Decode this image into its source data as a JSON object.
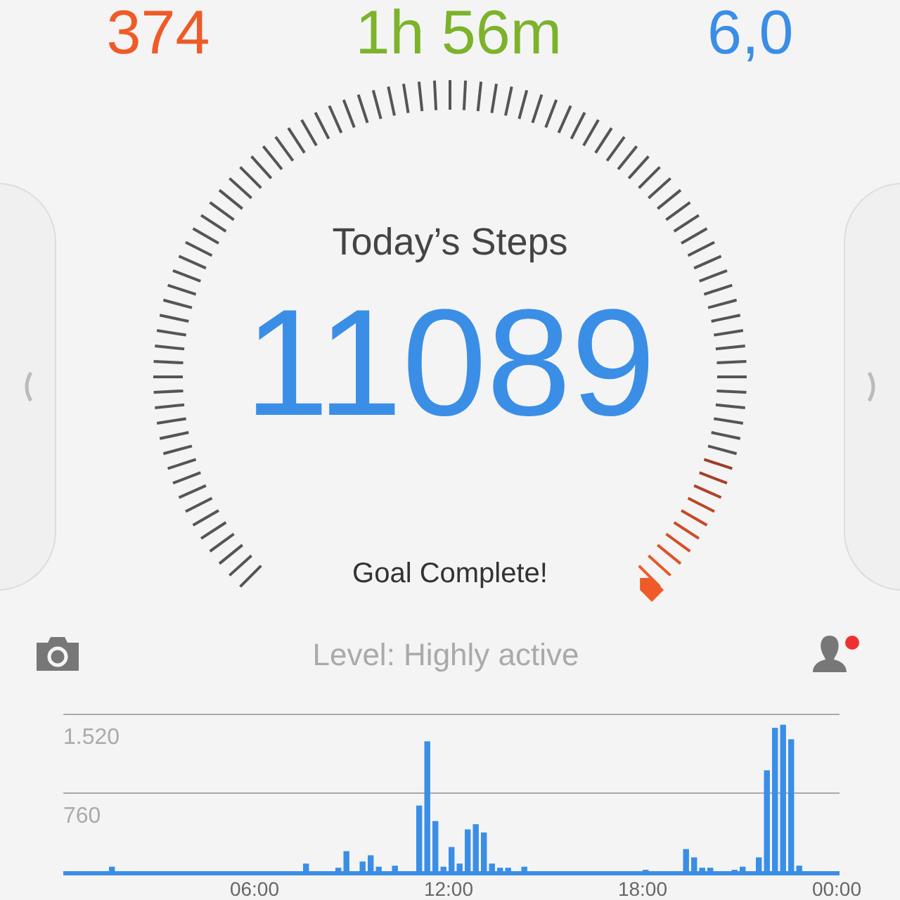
{
  "stats": [
    {
      "value": "374",
      "color": "#f05a28"
    },
    {
      "value": "1h 56m",
      "color": "#7cb32a"
    },
    {
      "value": "6,0",
      "color": "#3a8ee6"
    }
  ],
  "gauge": {
    "title": "Today’s Steps",
    "value": "11089",
    "status": "Goal Complete!"
  },
  "level_text": "Level: Highly active",
  "profile": {
    "notification": true
  },
  "chart_data": {
    "type": "bar",
    "x": [
      1.5,
      7.5,
      8.5,
      8.75,
      9.25,
      9.5,
      9.75,
      10.25,
      11,
      11.25,
      11.5,
      11.75,
      12,
      12.25,
      12.5,
      12.75,
      13,
      13.25,
      13.5,
      13.75,
      14.25,
      18,
      19.25,
      19.5,
      19.75,
      20,
      20.75,
      21,
      21.5,
      21.75,
      22,
      22.25,
      22.5,
      22.75
    ],
    "values": [
      50,
      80,
      40,
      200,
      100,
      160,
      50,
      60,
      640,
      1260,
      490,
      50,
      240,
      80,
      410,
      460,
      380,
      80,
      40,
      40,
      50,
      20,
      220,
      140,
      40,
      40,
      20,
      50,
      140,
      980,
      1390,
      1420,
      1280,
      60
    ],
    "xlim": [
      0,
      24
    ],
    "ylim": [
      0,
      1520
    ],
    "xticks": [
      {
        "value": 6,
        "label": "06:00"
      },
      {
        "value": 12,
        "label": "12:00"
      },
      {
        "value": 18,
        "label": "18:00"
      },
      {
        "value": 24,
        "label": "00:00"
      }
    ],
    "yticks": [
      {
        "value": 760,
        "label": "760"
      },
      {
        "value": 1520,
        "label": "1.520"
      }
    ]
  }
}
